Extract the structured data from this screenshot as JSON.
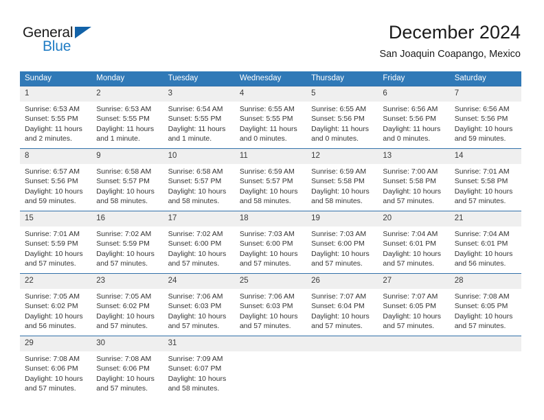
{
  "brand": {
    "name_part1": "General",
    "name_part2": "Blue",
    "logo_icon": "triangle-icon",
    "accent_color": "#1f7cc4",
    "triangle_color": "#1262a8"
  },
  "header": {
    "month_title": "December 2024",
    "location": "San Joaquin Coapango, Mexico"
  },
  "calendar": {
    "header_bg": "#3079b7",
    "daynum_bg": "#efefef",
    "row_border": "#2f6fa8",
    "weekday_headers": [
      "Sunday",
      "Monday",
      "Tuesday",
      "Wednesday",
      "Thursday",
      "Friday",
      "Saturday"
    ],
    "weeks": [
      [
        {
          "day": "1",
          "sunrise": "Sunrise: 6:53 AM",
          "sunset": "Sunset: 5:55 PM",
          "daylight_line1": "Daylight: 11 hours",
          "daylight_line2": "and 2 minutes."
        },
        {
          "day": "2",
          "sunrise": "Sunrise: 6:53 AM",
          "sunset": "Sunset: 5:55 PM",
          "daylight_line1": "Daylight: 11 hours",
          "daylight_line2": "and 1 minute."
        },
        {
          "day": "3",
          "sunrise": "Sunrise: 6:54 AM",
          "sunset": "Sunset: 5:55 PM",
          "daylight_line1": "Daylight: 11 hours",
          "daylight_line2": "and 1 minute."
        },
        {
          "day": "4",
          "sunrise": "Sunrise: 6:55 AM",
          "sunset": "Sunset: 5:55 PM",
          "daylight_line1": "Daylight: 11 hours",
          "daylight_line2": "and 0 minutes."
        },
        {
          "day": "5",
          "sunrise": "Sunrise: 6:55 AM",
          "sunset": "Sunset: 5:56 PM",
          "daylight_line1": "Daylight: 11 hours",
          "daylight_line2": "and 0 minutes."
        },
        {
          "day": "6",
          "sunrise": "Sunrise: 6:56 AM",
          "sunset": "Sunset: 5:56 PM",
          "daylight_line1": "Daylight: 11 hours",
          "daylight_line2": "and 0 minutes."
        },
        {
          "day": "7",
          "sunrise": "Sunrise: 6:56 AM",
          "sunset": "Sunset: 5:56 PM",
          "daylight_line1": "Daylight: 10 hours",
          "daylight_line2": "and 59 minutes."
        }
      ],
      [
        {
          "day": "8",
          "sunrise": "Sunrise: 6:57 AM",
          "sunset": "Sunset: 5:56 PM",
          "daylight_line1": "Daylight: 10 hours",
          "daylight_line2": "and 59 minutes."
        },
        {
          "day": "9",
          "sunrise": "Sunrise: 6:58 AM",
          "sunset": "Sunset: 5:57 PM",
          "daylight_line1": "Daylight: 10 hours",
          "daylight_line2": "and 58 minutes."
        },
        {
          "day": "10",
          "sunrise": "Sunrise: 6:58 AM",
          "sunset": "Sunset: 5:57 PM",
          "daylight_line1": "Daylight: 10 hours",
          "daylight_line2": "and 58 minutes."
        },
        {
          "day": "11",
          "sunrise": "Sunrise: 6:59 AM",
          "sunset": "Sunset: 5:57 PM",
          "daylight_line1": "Daylight: 10 hours",
          "daylight_line2": "and 58 minutes."
        },
        {
          "day": "12",
          "sunrise": "Sunrise: 6:59 AM",
          "sunset": "Sunset: 5:58 PM",
          "daylight_line1": "Daylight: 10 hours",
          "daylight_line2": "and 58 minutes."
        },
        {
          "day": "13",
          "sunrise": "Sunrise: 7:00 AM",
          "sunset": "Sunset: 5:58 PM",
          "daylight_line1": "Daylight: 10 hours",
          "daylight_line2": "and 57 minutes."
        },
        {
          "day": "14",
          "sunrise": "Sunrise: 7:01 AM",
          "sunset": "Sunset: 5:58 PM",
          "daylight_line1": "Daylight: 10 hours",
          "daylight_line2": "and 57 minutes."
        }
      ],
      [
        {
          "day": "15",
          "sunrise": "Sunrise: 7:01 AM",
          "sunset": "Sunset: 5:59 PM",
          "daylight_line1": "Daylight: 10 hours",
          "daylight_line2": "and 57 minutes."
        },
        {
          "day": "16",
          "sunrise": "Sunrise: 7:02 AM",
          "sunset": "Sunset: 5:59 PM",
          "daylight_line1": "Daylight: 10 hours",
          "daylight_line2": "and 57 minutes."
        },
        {
          "day": "17",
          "sunrise": "Sunrise: 7:02 AM",
          "sunset": "Sunset: 6:00 PM",
          "daylight_line1": "Daylight: 10 hours",
          "daylight_line2": "and 57 minutes."
        },
        {
          "day": "18",
          "sunrise": "Sunrise: 7:03 AM",
          "sunset": "Sunset: 6:00 PM",
          "daylight_line1": "Daylight: 10 hours",
          "daylight_line2": "and 57 minutes."
        },
        {
          "day": "19",
          "sunrise": "Sunrise: 7:03 AM",
          "sunset": "Sunset: 6:00 PM",
          "daylight_line1": "Daylight: 10 hours",
          "daylight_line2": "and 57 minutes."
        },
        {
          "day": "20",
          "sunrise": "Sunrise: 7:04 AM",
          "sunset": "Sunset: 6:01 PM",
          "daylight_line1": "Daylight: 10 hours",
          "daylight_line2": "and 57 minutes."
        },
        {
          "day": "21",
          "sunrise": "Sunrise: 7:04 AM",
          "sunset": "Sunset: 6:01 PM",
          "daylight_line1": "Daylight: 10 hours",
          "daylight_line2": "and 56 minutes."
        }
      ],
      [
        {
          "day": "22",
          "sunrise": "Sunrise: 7:05 AM",
          "sunset": "Sunset: 6:02 PM",
          "daylight_line1": "Daylight: 10 hours",
          "daylight_line2": "and 56 minutes."
        },
        {
          "day": "23",
          "sunrise": "Sunrise: 7:05 AM",
          "sunset": "Sunset: 6:02 PM",
          "daylight_line1": "Daylight: 10 hours",
          "daylight_line2": "and 57 minutes."
        },
        {
          "day": "24",
          "sunrise": "Sunrise: 7:06 AM",
          "sunset": "Sunset: 6:03 PM",
          "daylight_line1": "Daylight: 10 hours",
          "daylight_line2": "and 57 minutes."
        },
        {
          "day": "25",
          "sunrise": "Sunrise: 7:06 AM",
          "sunset": "Sunset: 6:03 PM",
          "daylight_line1": "Daylight: 10 hours",
          "daylight_line2": "and 57 minutes."
        },
        {
          "day": "26",
          "sunrise": "Sunrise: 7:07 AM",
          "sunset": "Sunset: 6:04 PM",
          "daylight_line1": "Daylight: 10 hours",
          "daylight_line2": "and 57 minutes."
        },
        {
          "day": "27",
          "sunrise": "Sunrise: 7:07 AM",
          "sunset": "Sunset: 6:05 PM",
          "daylight_line1": "Daylight: 10 hours",
          "daylight_line2": "and 57 minutes."
        },
        {
          "day": "28",
          "sunrise": "Sunrise: 7:08 AM",
          "sunset": "Sunset: 6:05 PM",
          "daylight_line1": "Daylight: 10 hours",
          "daylight_line2": "and 57 minutes."
        }
      ],
      [
        {
          "day": "29",
          "sunrise": "Sunrise: 7:08 AM",
          "sunset": "Sunset: 6:06 PM",
          "daylight_line1": "Daylight: 10 hours",
          "daylight_line2": "and 57 minutes."
        },
        {
          "day": "30",
          "sunrise": "Sunrise: 7:08 AM",
          "sunset": "Sunset: 6:06 PM",
          "daylight_line1": "Daylight: 10 hours",
          "daylight_line2": "and 57 minutes."
        },
        {
          "day": "31",
          "sunrise": "Sunrise: 7:09 AM",
          "sunset": "Sunset: 6:07 PM",
          "daylight_line1": "Daylight: 10 hours",
          "daylight_line2": "and 58 minutes."
        },
        {
          "day": "",
          "sunrise": "",
          "sunset": "",
          "daylight_line1": "",
          "daylight_line2": ""
        },
        {
          "day": "",
          "sunrise": "",
          "sunset": "",
          "daylight_line1": "",
          "daylight_line2": ""
        },
        {
          "day": "",
          "sunrise": "",
          "sunset": "",
          "daylight_line1": "",
          "daylight_line2": ""
        },
        {
          "day": "",
          "sunrise": "",
          "sunset": "",
          "daylight_line1": "",
          "daylight_line2": ""
        }
      ]
    ]
  }
}
